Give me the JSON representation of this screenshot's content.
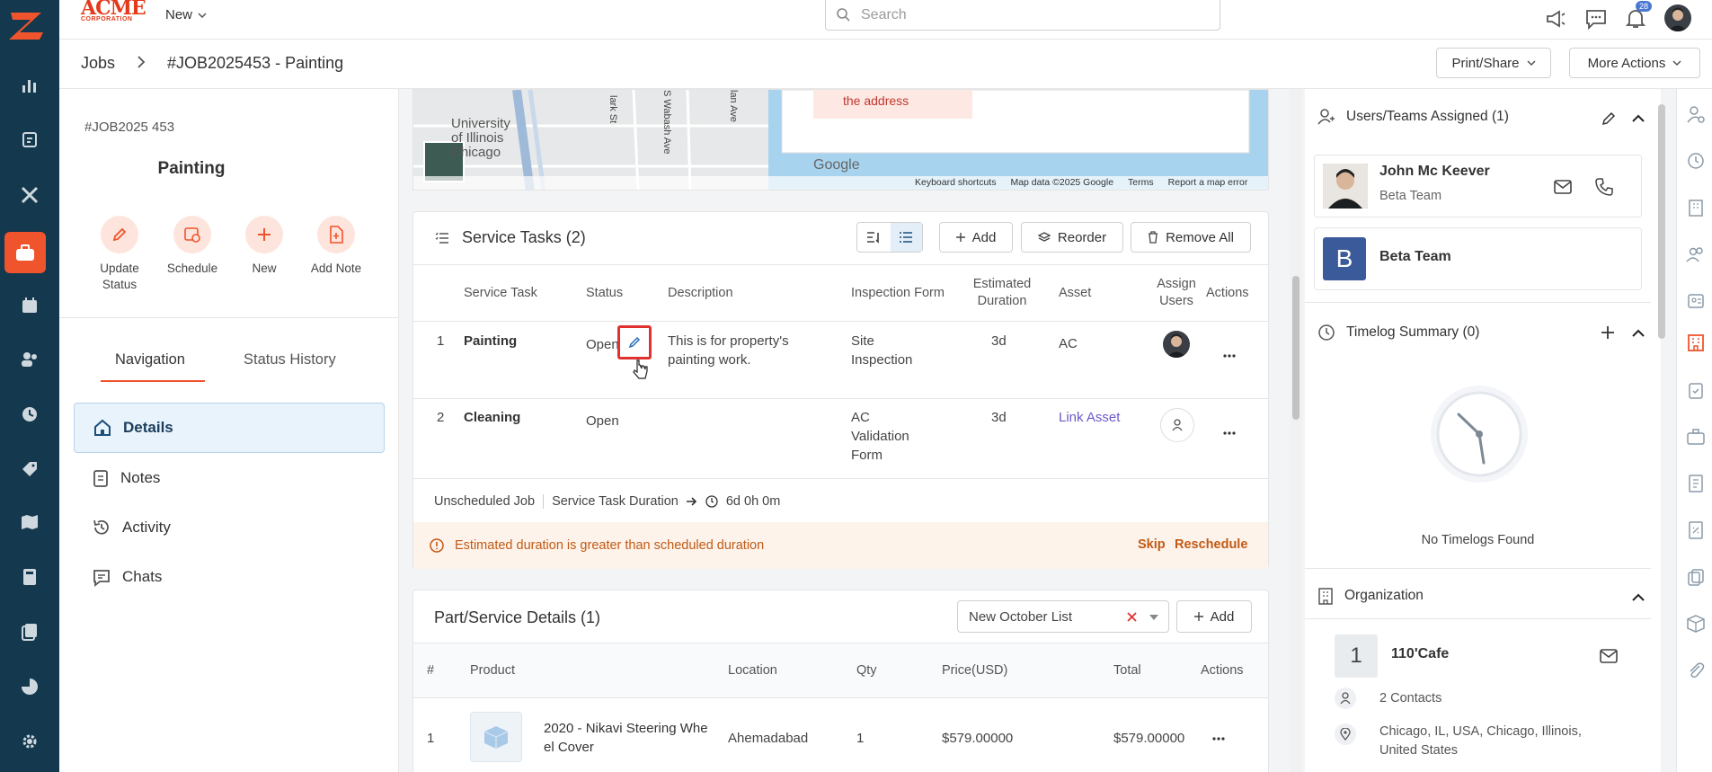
{
  "topbar": {
    "brand_main": "ACME",
    "brand_sub": "CORPORATION",
    "new_label": "New",
    "search_placeholder": "Search",
    "notification_count": "28"
  },
  "breadcrumb": {
    "parent": "Jobs",
    "current": "#JOB2025453 - Painting"
  },
  "header_actions": {
    "print_share": "Print/Share",
    "more_actions": "More Actions"
  },
  "job": {
    "number": "#JOB2025 453",
    "title": "Painting",
    "actions": [
      {
        "label": "Update Status"
      },
      {
        "label": "Schedule"
      },
      {
        "label": "New"
      },
      {
        "label": "Add Note"
      }
    ],
    "tabs": [
      "Navigation",
      "Status History"
    ],
    "nav": [
      "Details",
      "Notes",
      "Activity",
      "Chats"
    ]
  },
  "map": {
    "alert_text": "the address",
    "labels": {
      "univ1": "University",
      "univ2": "of Illinois",
      "univ3": "Chicago",
      "street1": "lark St",
      "street2": "S Wabash Ave",
      "street3": "lan Ave",
      "logo": "Google",
      "shortcuts": "Keyboard shortcuts",
      "copyright": "Map data ©2025 Google",
      "terms": "Terms",
      "report": "Report a map error"
    }
  },
  "service_tasks": {
    "title": "Service Tasks (2)",
    "add": "Add",
    "reorder": "Reorder",
    "remove_all": "Remove All",
    "columns": [
      "Service Task",
      "Status",
      "Description",
      "Inspection Form",
      "Estimated Duration",
      "Asset",
      "Assign Users",
      "Actions"
    ],
    "rows": [
      {
        "num": "1",
        "task": "Painting",
        "status": "Open",
        "description": "This is for property's painting work.",
        "form": "Site Inspection",
        "duration": "3d",
        "asset": "AC"
      },
      {
        "num": "2",
        "task": "Cleaning",
        "status": "Open",
        "description": "",
        "form": "AC Validation Form",
        "duration": "3d",
        "asset": "Link Asset"
      }
    ],
    "footer": {
      "unscheduled": "Unscheduled Job",
      "duration_label": "Service Task Duration",
      "duration_value": "6d 0h 0m"
    },
    "warning": {
      "text": "Estimated duration is greater than scheduled duration",
      "skip": "Skip",
      "reschedule": "Reschedule"
    }
  },
  "parts": {
    "title": "Part/Service Details (1)",
    "list_value": "New October List",
    "add": "Add",
    "columns": [
      "#",
      "Product",
      "Location",
      "Qty",
      "Price(USD)",
      "Total",
      "Actions"
    ],
    "rows": [
      {
        "num": "1",
        "product": "2020 - Nikavi Steering Whe el Cover",
        "location": "Ahemadabad",
        "qty": "1",
        "price": "$579.00000",
        "total": "$579.00000"
      }
    ]
  },
  "right": {
    "users_title": "Users/Teams Assigned (1)",
    "user_name": "John Mc Keever",
    "user_team": "Beta Team",
    "team_initial": "B",
    "team_name": "Beta Team",
    "timelog_title": "Timelog Summary (0)",
    "no_timelogs": "No Timelogs Found",
    "org_title": "Organization",
    "org_initial": "1",
    "org_name": "110'Cafe",
    "contacts": "2 Contacts",
    "address": "Chicago, IL, USA, Chicago, Illinois, United States"
  },
  "colors": {
    "sidebar": "#14384d",
    "accent": "#f0542d",
    "link": "#6a5acd",
    "warning_bg": "#fdf3ea",
    "warning_text": "#c25a16"
  }
}
